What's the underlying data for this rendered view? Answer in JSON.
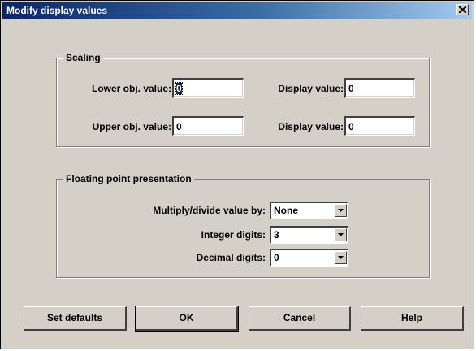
{
  "window": {
    "title": "Modify display values",
    "close_symbol": "close-icon"
  },
  "scaling": {
    "group_title": "Scaling",
    "lower_obj_label": "Lower obj. value:",
    "lower_obj_value": "0",
    "lower_display_label": "Display value:",
    "lower_display_value": "0",
    "upper_obj_label": "Upper obj. value:",
    "upper_obj_value": "0",
    "upper_display_label": "Display value:",
    "upper_display_value": "0"
  },
  "floating": {
    "group_title": "Floating point presentation",
    "multiply_label": "Multiply/divide value by:",
    "multiply_value": "None",
    "integer_label": "Integer digits:",
    "integer_value": "3",
    "decimal_label": "Decimal digits:",
    "decimal_value": "0"
  },
  "buttons": {
    "set_defaults": "Set defaults",
    "ok": "OK",
    "cancel": "Cancel",
    "help": "Help"
  },
  "colors": {
    "dialog_face": "#d4d0c8",
    "titlebar_start": "#0a246a",
    "titlebar_end": "#a6caf0"
  }
}
